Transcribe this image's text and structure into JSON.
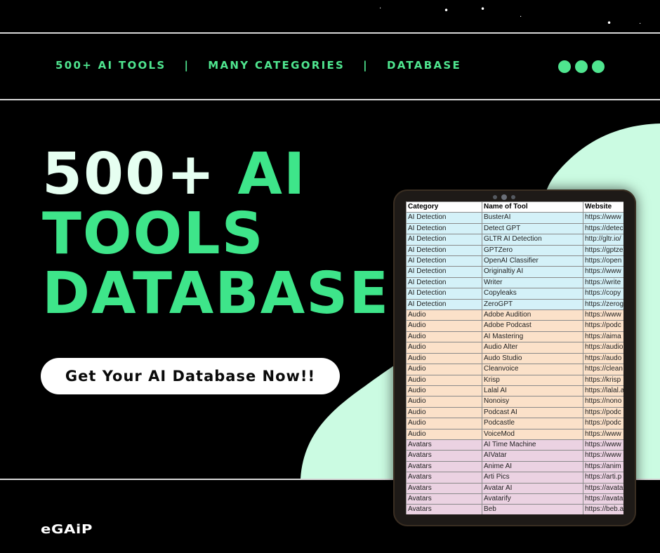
{
  "nav": {
    "item1": "500+ AI TOOLS",
    "sep1": "|",
    "item2": "MANY CATEGORIES",
    "sep2": "|",
    "item3": "DATABASE"
  },
  "headline": {
    "line1_white": "500+",
    "line1_green": "AI",
    "line2": "TOOLS",
    "line3": "DATABASE"
  },
  "cta_label": "Get Your AI Database Now!!",
  "logo_text": "eGAiP",
  "colors": {
    "accent_green": "#4fe58f",
    "headline_green": "#3ee58a",
    "blob_mint": "#cbfbe2",
    "background": "#000000"
  },
  "table": {
    "headers": [
      "Category",
      "Name of Tool",
      "Website"
    ],
    "rows": [
      {
        "cat": "AI Detection",
        "name": "BusterAI",
        "site": "https://www"
      },
      {
        "cat": "AI Detection",
        "name": "Detect GPT",
        "site": "https://detec"
      },
      {
        "cat": "AI Detection",
        "name": "GLTR AI Detection",
        "site": "http://gltr.io/"
      },
      {
        "cat": "AI Detection",
        "name": "GPTZero",
        "site": "https://gptze"
      },
      {
        "cat": "AI Detection",
        "name": "OpenAI Classifier",
        "site": "https://open"
      },
      {
        "cat": "AI Detection",
        "name": "Originaltiy AI",
        "site": "https://www"
      },
      {
        "cat": "AI Detection",
        "name": "Writer",
        "site": "https://write"
      },
      {
        "cat": "AI Detection",
        "name": "Copyleaks",
        "site": "https://copy"
      },
      {
        "cat": "AI Detection",
        "name": "ZeroGPT",
        "site": "https://zerog"
      },
      {
        "cat": "Audio",
        "name": "Adobe Audition",
        "site": "https://www"
      },
      {
        "cat": "Audio",
        "name": "Adobe Podcast",
        "site": "https://podc"
      },
      {
        "cat": "Audio",
        "name": "AI Mastering",
        "site": "https://aima"
      },
      {
        "cat": "Audio",
        "name": "Audio Alter",
        "site": "https://audio"
      },
      {
        "cat": "Audio",
        "name": "Audo Studio",
        "site": "https://audo"
      },
      {
        "cat": "Audio",
        "name": "Cleanvoice",
        "site": "https://clean"
      },
      {
        "cat": "Audio",
        "name": "Krisp",
        "site": "https://krisp"
      },
      {
        "cat": "Audio",
        "name": "Lalal AI",
        "site": "https://lalal.a"
      },
      {
        "cat": "Audio",
        "name": "Nonoisy",
        "site": "https://nono"
      },
      {
        "cat": "Audio",
        "name": "Podcast AI",
        "site": "https://podc"
      },
      {
        "cat": "Audio",
        "name": "Podcastle",
        "site": "https://podc"
      },
      {
        "cat": "Audio",
        "name": "VoiceMod",
        "site": "https://www"
      },
      {
        "cat": "Avatars",
        "name": "AI Time Machine",
        "site": "https://www"
      },
      {
        "cat": "Avatars",
        "name": "AIVatar",
        "site": "https://www"
      },
      {
        "cat": "Avatars",
        "name": "Anime AI",
        "site": "https://anim"
      },
      {
        "cat": "Avatars",
        "name": "Arti Pics",
        "site": "https://arti.p"
      },
      {
        "cat": "Avatars",
        "name": "Avatar AI",
        "site": "https://avata"
      },
      {
        "cat": "Avatars",
        "name": "Avatarify",
        "site": "https://avata"
      },
      {
        "cat": "Avatars",
        "name": "Beb",
        "site": "https://beb.a"
      }
    ]
  }
}
